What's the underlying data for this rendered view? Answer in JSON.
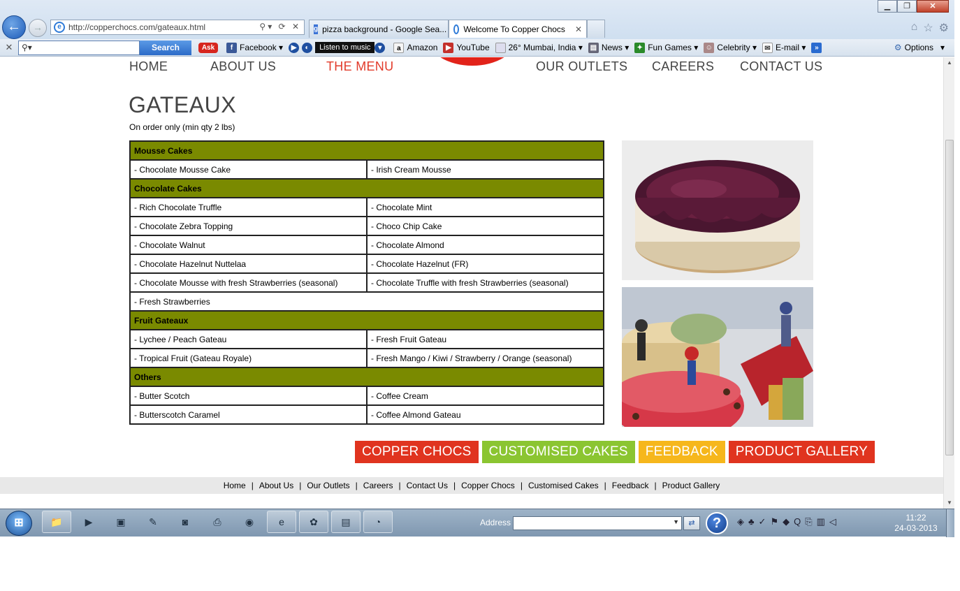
{
  "browser": {
    "url": "http://copperchocs.com/gateaux.html",
    "tabs": [
      {
        "label": "pizza background - Google Sea..."
      },
      {
        "label": "Welcome To Copper Chocs"
      }
    ],
    "toolbar": {
      "search_button": "Search",
      "items": [
        "Facebook",
        "Listen to music",
        "Amazon",
        "YouTube",
        "26° Mumbai, India",
        "News",
        "Fun Games",
        "Celebrity",
        "E-mail"
      ],
      "options": "Options"
    }
  },
  "site": {
    "nav": [
      "HOME",
      "ABOUT US",
      "THE MENU",
      "OUR OUTLETS",
      "CAREERS",
      "CONTACT US"
    ],
    "title": "GATEAUX",
    "note": "On order only (min qty 2 lbs)",
    "menu": [
      {
        "category": "Mousse Cakes",
        "rows": [
          [
            "- Chocolate Mousse Cake",
            "- Irish Cream Mousse"
          ]
        ]
      },
      {
        "category": "Chocolate Cakes",
        "rows": [
          [
            "- Rich Chocolate Truffle",
            "- Chocolate Mint"
          ],
          [
            "- Chocolate Zebra Topping",
            "- Choco Chip Cake"
          ],
          [
            "- Chocolate Walnut",
            "- Chocolate Almond"
          ],
          [
            "- Chocolate Hazelnut Nuttelaa",
            "- Chocolate Hazelnut (FR)"
          ],
          [
            "- Chocolate Mousse with fresh Strawberries (seasonal)",
            "- Chocolate Truffle with fresh Strawberries (seasonal)"
          ],
          [
            "- Fresh Strawberries"
          ]
        ]
      },
      {
        "category": "Fruit Gateaux",
        "rows": [
          [
            "- Lychee / Peach Gateau",
            "- Fresh Fruit Gateau"
          ],
          [
            "- Tropical Fruit (Gateau Royale)",
            "- Fresh Mango / Kiwi / Strawberry / Orange (seasonal)"
          ]
        ]
      },
      {
        "category": "Others",
        "rows": [
          [
            "- Butter Scotch",
            "- Coffee Cream"
          ],
          [
            "- Butterscotch Caramel",
            "- Coffee Almond Gateau"
          ]
        ]
      }
    ],
    "buttons": [
      "COPPER CHOCS",
      "CUSTOMISED CAKES",
      "FEEDBACK",
      "PRODUCT GALLERY"
    ],
    "footer_links": [
      "Home",
      "About Us",
      "Our Outlets",
      "Careers",
      "Contact Us",
      "Copper Chocs",
      "Customised Cakes",
      "Feedback",
      "Product Gallery"
    ]
  },
  "taskbar": {
    "address_label": "Address",
    "time": "11:22",
    "date": "24-03-2013"
  },
  "colors": {
    "category_bg": "#7a8a00",
    "nav_active": "#e23b2b",
    "btn_red": "#e0341f",
    "btn_green": "#8bc531",
    "btn_yellow": "#f6b71c"
  }
}
